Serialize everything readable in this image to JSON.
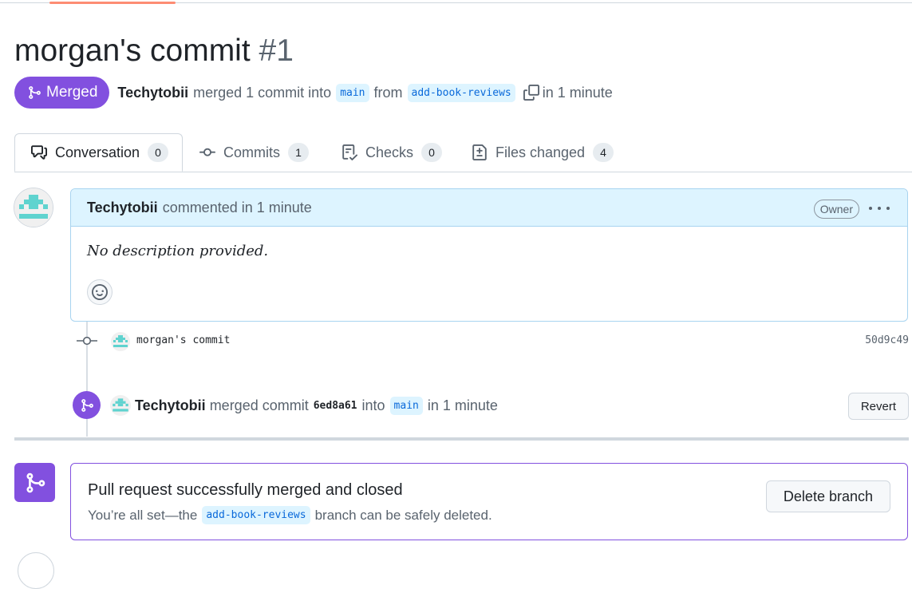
{
  "pr": {
    "title": "morgan's commit",
    "number": "#1",
    "state": "Merged",
    "author": "Techytobii",
    "merged_text": "merged 1 commit into",
    "base_branch": "main",
    "from_text": "from",
    "head_branch": "add-book-reviews",
    "time": "in 1 minute"
  },
  "tabs": [
    {
      "label": "Conversation",
      "count": "0",
      "icon": "comment-discussion-icon"
    },
    {
      "label": "Commits",
      "count": "1",
      "icon": "git-commit-icon"
    },
    {
      "label": "Checks",
      "count": "0",
      "icon": "checklist-icon"
    },
    {
      "label": "Files changed",
      "count": "4",
      "icon": "file-diff-icon"
    }
  ],
  "comment": {
    "author": "Techytobii",
    "action": "commented in 1 minute",
    "role_badge": "Owner",
    "body": "No description provided."
  },
  "commit": {
    "message": "morgan's commit",
    "sha": "50d9c49"
  },
  "merge_event": {
    "author": "Techytobii",
    "text_before": "merged commit",
    "sha": "6ed8a61",
    "text_into": "into",
    "branch": "main",
    "time": "in 1 minute",
    "revert_label": "Revert"
  },
  "merged_box": {
    "title": "Pull request successfully merged and closed",
    "sub_before": "You’re all set—the",
    "branch": "add-book-reviews",
    "sub_after": "branch can be safely deleted.",
    "delete_label": "Delete branch"
  },
  "colors": {
    "merged_purple": "#8250df",
    "link_blue": "#0969da",
    "avatar_teal": "#5fd3cf"
  }
}
